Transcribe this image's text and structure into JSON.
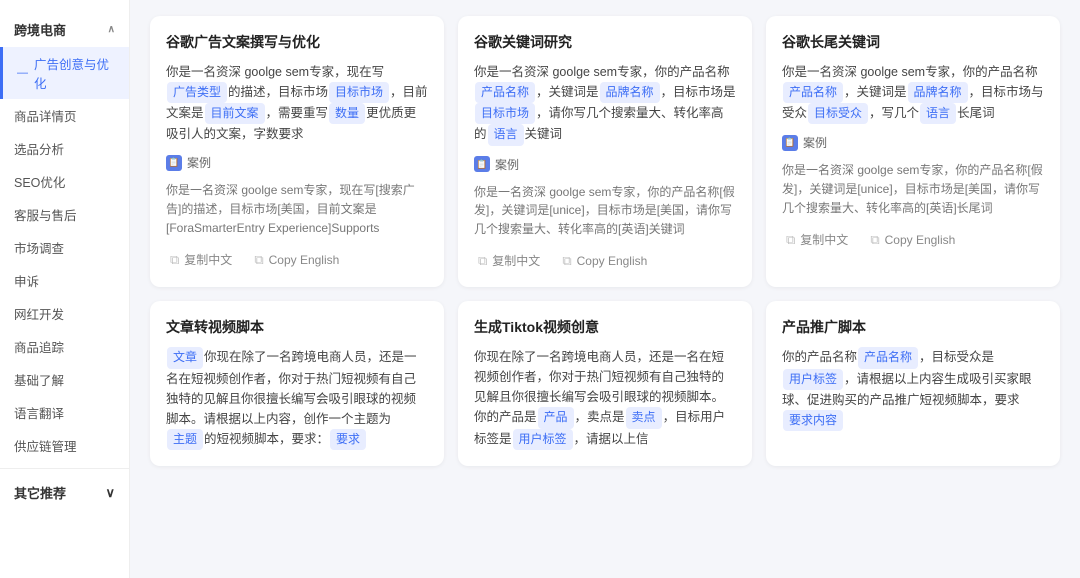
{
  "sidebar": {
    "section1": {
      "label": "跨境电商",
      "chevron": "∧",
      "items": [
        {
          "id": "ad-creative",
          "label": "广告创意与优化",
          "active": true
        },
        {
          "id": "product-detail",
          "label": "商品详情页",
          "active": false
        },
        {
          "id": "product-selection",
          "label": "选品分析",
          "active": false
        },
        {
          "id": "seo",
          "label": "SEO优化",
          "active": false
        },
        {
          "id": "customer-service",
          "label": "客服与售后",
          "active": false
        },
        {
          "id": "market-research",
          "label": "市场调查",
          "active": false
        },
        {
          "id": "dispute",
          "label": "申诉",
          "active": false
        },
        {
          "id": "influencer",
          "label": "网红开发",
          "active": false
        },
        {
          "id": "product-tracking",
          "label": "商品追踪",
          "active": false
        },
        {
          "id": "basics",
          "label": "基础了解",
          "active": false
        },
        {
          "id": "translation",
          "label": "语言翻译",
          "active": false
        },
        {
          "id": "supply-chain",
          "label": "供应链管理",
          "active": false
        }
      ]
    },
    "section2": {
      "label": "其它推荐",
      "chevron": "∨"
    }
  },
  "cards": [
    {
      "id": "google-ad-copy",
      "title": "谷歌广告文案撰写与优化",
      "desc_parts": [
        {
          "type": "text",
          "value": "你是一名资深 goolge sem专家，现在写"
        },
        {
          "type": "tag",
          "value": "广告类型"
        },
        {
          "type": "text",
          "value": "的描述，目标市场"
        },
        {
          "type": "tag",
          "value": "目标市场"
        },
        {
          "type": "text",
          "value": "，目前文案是"
        },
        {
          "type": "tag",
          "value": "目前文案"
        },
        {
          "type": "text",
          "value": "，需要重写"
        },
        {
          "type": "tag",
          "value": "数量"
        },
        {
          "type": "text",
          "value": "更优质更吸引人的文案，字数要求"
        }
      ],
      "example_label": "案例",
      "example_text": "你是一名资深 goolge sem专家，现在写[搜索广告]的描述，目标市场[美国，目前文案是 [ForaSmarterEntry Experience]Supports",
      "actions": [
        {
          "id": "copy-zh",
          "label": "复制中文"
        },
        {
          "id": "copy-en",
          "label": "Copy English"
        }
      ]
    },
    {
      "id": "google-keyword-research",
      "title": "谷歌关键词研究",
      "desc_parts": [
        {
          "type": "text",
          "value": "你是一名资深 goolge sem专家，你的产品名称"
        },
        {
          "type": "tag",
          "value": "产品名称"
        },
        {
          "type": "text",
          "value": "，关键词是"
        },
        {
          "type": "tag",
          "value": "品牌名称"
        },
        {
          "type": "text",
          "value": "，目标市场是"
        },
        {
          "type": "tag",
          "value": "目标市场"
        },
        {
          "type": "text",
          "value": "，请你写几个搜索量大、转化率高的"
        },
        {
          "type": "tag",
          "value": "语言"
        },
        {
          "type": "text",
          "value": "关键词"
        }
      ],
      "example_label": "案例",
      "example_text": "你是一名资深 goolge sem专家，你的产品名称[假发]，关键词是[unice]，目标市场是[美国，请你写几个搜索量大、转化率高的[英语]关键词",
      "actions": [
        {
          "id": "copy-zh",
          "label": "复制中文"
        },
        {
          "id": "copy-en",
          "label": "Copy English"
        }
      ]
    },
    {
      "id": "google-longtail",
      "title": "谷歌长尾关键词",
      "desc_parts": [
        {
          "type": "text",
          "value": "你是一名资深 goolge sem专家，你的产品名称"
        },
        {
          "type": "tag",
          "value": "产品名称"
        },
        {
          "type": "text",
          "value": "，关键词是"
        },
        {
          "type": "tag",
          "value": "品牌名称"
        },
        {
          "type": "text",
          "value": "，目标市场与受众"
        },
        {
          "type": "tag",
          "value": "目标受众"
        },
        {
          "type": "text",
          "value": "，写几个"
        },
        {
          "type": "tag",
          "value": "语言"
        },
        {
          "type": "text",
          "value": "长尾词"
        }
      ],
      "example_label": "案例",
      "example_text": "你是一名资深 goolge sem专家，你的产品名称[假发]，关键词是[unice]，目标市场是[美国，请你写几个搜索量大、转化率高的[英语]长尾词",
      "actions": [
        {
          "id": "copy-zh",
          "label": "复制中文"
        },
        {
          "id": "copy-en",
          "label": "Copy English"
        }
      ]
    },
    {
      "id": "article-to-video",
      "title": "文章转视频脚本",
      "desc_parts": [
        {
          "type": "tag",
          "value": "文章"
        },
        {
          "type": "text",
          "value": "你现在除了一名跨境电商人员，还是一名在短视频创作者，你对于热门短视频有自己独特的见解且你很擅长编写会吸引眼球的视频脚本。请根据以上内容，创作一个主题为"
        },
        {
          "type": "tag",
          "value": "主题"
        },
        {
          "type": "text",
          "value": "的短视频脚本，要求："
        },
        {
          "type": "tag",
          "value": "要求"
        }
      ],
      "example_label": null,
      "example_text": null,
      "actions": []
    },
    {
      "id": "tiktok-video-idea",
      "title": "生成Tiktok视频创意",
      "desc_parts": [
        {
          "type": "text",
          "value": "你现在除了一名跨境电商人员，还是一名在短视频创作者，你对于热门短视频有自己独特的见解且你很擅长编写会吸引眼球的视频脚本。你的产品是"
        },
        {
          "type": "tag",
          "value": "产品"
        },
        {
          "type": "text",
          "value": "，卖点是"
        },
        {
          "type": "tag",
          "value": "卖点"
        },
        {
          "type": "text",
          "value": "，目标用户标签是"
        },
        {
          "type": "tag",
          "value": "用户标签"
        },
        {
          "type": "text",
          "value": "，请据以上信"
        }
      ],
      "example_label": null,
      "example_text": null,
      "actions": []
    },
    {
      "id": "product-promo-script",
      "title": "产品推广脚本",
      "desc_parts": [
        {
          "type": "text",
          "value": "你的产品名称"
        },
        {
          "type": "tag",
          "value": "产品名称"
        },
        {
          "type": "text",
          "value": "，目标受众是"
        },
        {
          "type": "tag",
          "value": "用户标签"
        },
        {
          "type": "text",
          "value": "，请根据以上内容生成吸引买家眼球、促进购买的产品推广短视频脚本，要求"
        },
        {
          "type": "tag",
          "value": "要求内容"
        }
      ],
      "example_label": null,
      "example_text": null,
      "actions": []
    }
  ],
  "icons": {
    "copy": "⧉",
    "example": "📋",
    "chevron_up": "∧",
    "chevron_down": "∨"
  }
}
